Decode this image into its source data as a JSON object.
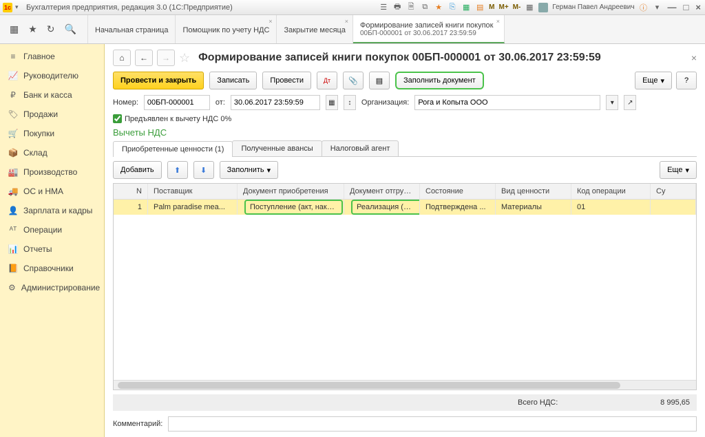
{
  "titlebar": {
    "app_title": "Бухгалтерия предприятия, редакция 3.0 (1С:Предприятие)",
    "m_labels": [
      "M",
      "M+",
      "M-"
    ],
    "user_name": "Герман Павел Андреевич"
  },
  "tabs": [
    {
      "label": "Начальная страница",
      "closable": false
    },
    {
      "label": "Помощник по учету НДС",
      "closable": true
    },
    {
      "label": "Закрытие месяца",
      "closable": true
    },
    {
      "label": "Формирование записей книги покупок",
      "sub": "00БП-000001 от 30.06.2017 23:59:59",
      "closable": true,
      "active": true
    }
  ],
  "sidebar": [
    {
      "icon": "menu",
      "label": "Главное"
    },
    {
      "icon": "chart",
      "label": "Руководителю"
    },
    {
      "icon": "ruble",
      "label": "Банк и касса"
    },
    {
      "icon": "tag",
      "label": "Продажи"
    },
    {
      "icon": "cart",
      "label": "Покупки"
    },
    {
      "icon": "box",
      "label": "Склад"
    },
    {
      "icon": "factory",
      "label": "Производство"
    },
    {
      "icon": "truck",
      "label": "ОС и НМА"
    },
    {
      "icon": "person",
      "label": "Зарплата и кадры"
    },
    {
      "icon": "ops",
      "label": "Операции"
    },
    {
      "icon": "bars",
      "label": "Отчеты"
    },
    {
      "icon": "book",
      "label": "Справочники"
    },
    {
      "icon": "gear",
      "label": "Администрирование"
    }
  ],
  "page": {
    "title": "Формирование записей книги покупок 00БП-000001 от 30.06.2017 23:59:59",
    "toolbar": {
      "post_close": "Провести и закрыть",
      "write": "Записать",
      "post": "Провести",
      "fill_doc": "Заполнить документ",
      "more": "Еще"
    },
    "form": {
      "num_label": "Номер:",
      "num_value": "00БП-000001",
      "from_label": "от:",
      "date_value": "30.06.2017 23:59:59",
      "org_label": "Организация:",
      "org_value": "Рога и Копыта ООО",
      "vat_zero_label": "Предъявлен к вычету НДС 0%"
    },
    "section_title": "Вычеты НДС",
    "subtabs": [
      {
        "label": "Приобретенные ценности (1)",
        "active": true
      },
      {
        "label": "Полученные авансы"
      },
      {
        "label": "Налоговый агент"
      }
    ],
    "subtoolbar": {
      "add": "Добавить",
      "fill": "Заполнить",
      "more": "Еще"
    },
    "table": {
      "headers": {
        "n": "N",
        "supplier": "Поставщик",
        "doc_acq": "Документ приобретения",
        "doc_ship": "Документ отгрузки",
        "state": "Состояние",
        "valtype": "Вид ценности",
        "opcode": "Код операции",
        "sum": "Су"
      },
      "rows": [
        {
          "n": "1",
          "supplier": "Palm paradise mea...",
          "doc_acq": "Поступление (акт, накл...",
          "doc_ship": "Реализация (акт...",
          "state": "Подтверждена ...",
          "valtype": "Материалы",
          "opcode": "01",
          "sum": ""
        }
      ]
    },
    "totals": {
      "label": "Всего НДС:",
      "value": "8 995,65"
    },
    "comment_label": "Комментарий:"
  }
}
